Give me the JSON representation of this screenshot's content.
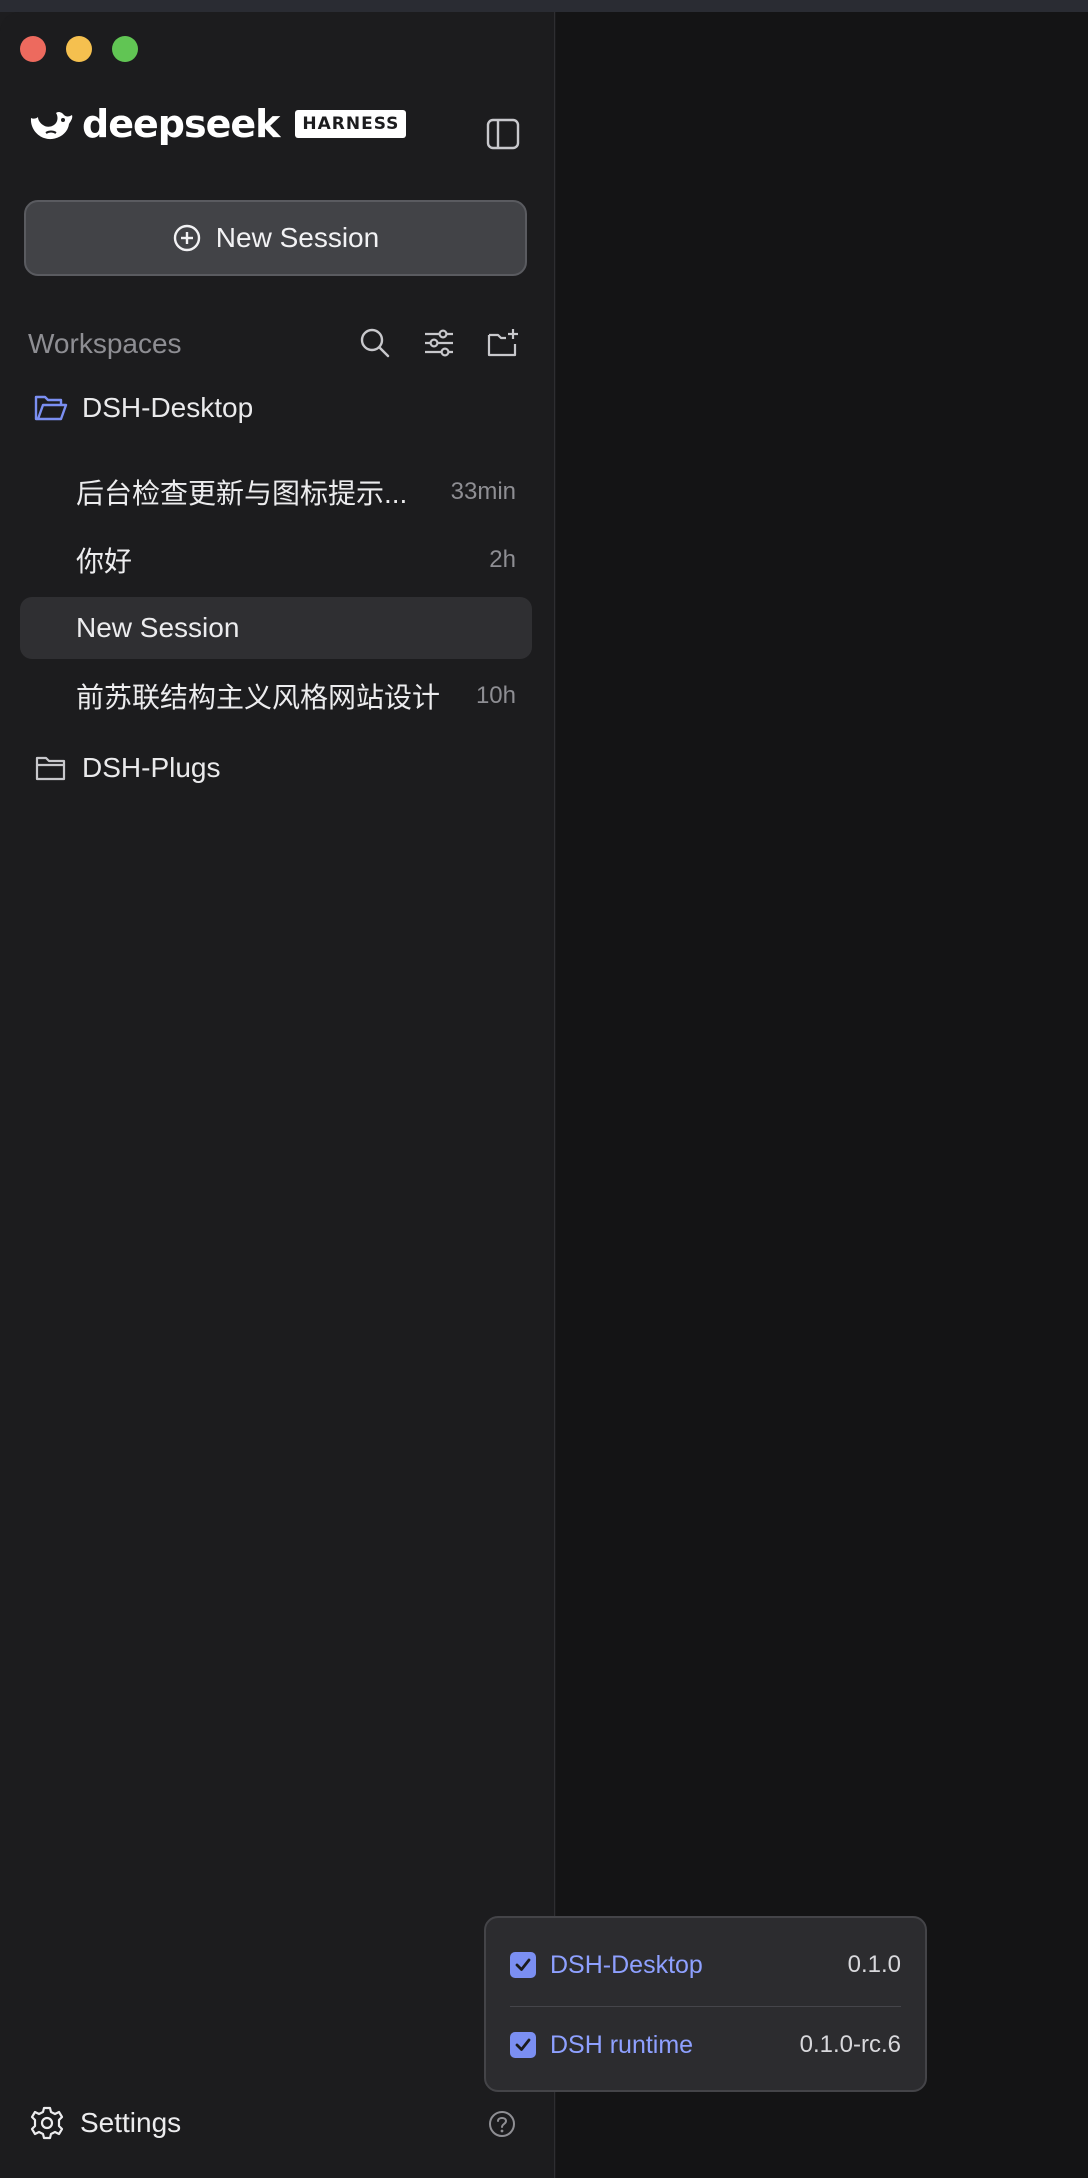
{
  "brand": {
    "name": "deepseek",
    "badge": "HARNESS"
  },
  "sidebar": {
    "new_session_label": "New Session",
    "workspaces_label": "Workspaces",
    "projects": [
      {
        "name": "DSH-Desktop",
        "expanded": true,
        "sessions": [
          {
            "title": "后台检查更新与图标提示...",
            "time": "33min",
            "active": false
          },
          {
            "title": "你好",
            "time": "2h",
            "active": false
          },
          {
            "title": "New Session",
            "time": "",
            "active": true
          },
          {
            "title": "前苏联结构主义风格网站设计",
            "time": "10h",
            "active": false
          }
        ]
      },
      {
        "name": "DSH-Plugs",
        "expanded": false,
        "sessions": []
      }
    ],
    "settings_label": "Settings"
  },
  "version_popup": {
    "items": [
      {
        "name": "DSH-Desktop",
        "version": "0.1.0",
        "checked": true
      },
      {
        "name": "DSH runtime",
        "version": "0.1.0-rc.6",
        "checked": true
      }
    ]
  },
  "colors": {
    "accent": "#7b8ff2",
    "folder_open": "#7b8ff2",
    "sidebar_bg": "#1c1c1e",
    "active_item_bg": "#2f2f32"
  }
}
